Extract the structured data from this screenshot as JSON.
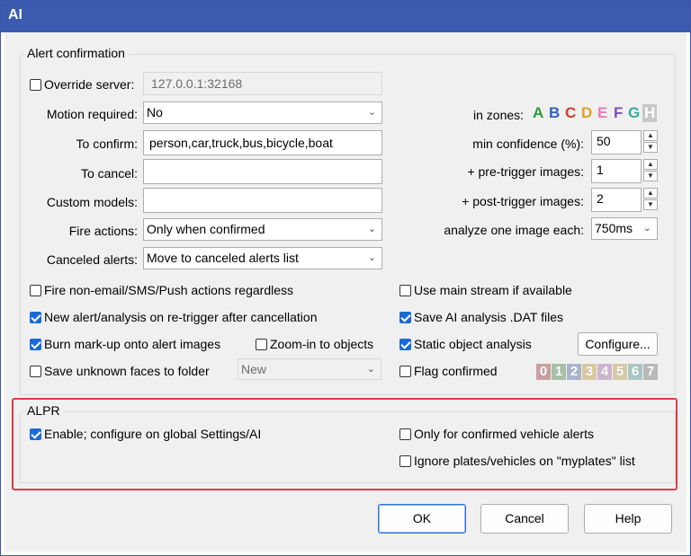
{
  "window": {
    "title": "AI"
  },
  "alert_confirmation": {
    "legend": "Alert confirmation",
    "override_server": {
      "label": "Override server:",
      "checked": false,
      "value": "127.0.0.1:32168"
    },
    "motion_required": {
      "label": "Motion required:",
      "value": "No"
    },
    "to_confirm": {
      "label": "To confirm:",
      "value": "person,car,truck,bus,bicycle,boat"
    },
    "to_cancel": {
      "label": "To cancel:",
      "value": ""
    },
    "custom_models": {
      "label": "Custom models:",
      "value": ""
    },
    "fire_actions": {
      "label": "Fire actions:",
      "value": "Only when confirmed"
    },
    "canceled_alerts": {
      "label": "Canceled alerts:",
      "value": "Move to canceled alerts list"
    },
    "in_zones": {
      "label": "in zones:",
      "letters": [
        "A",
        "B",
        "C",
        "D",
        "E",
        "F",
        "G",
        "H"
      ],
      "colors": [
        "#2e9a3a",
        "#2f5fc4",
        "#d23a2f",
        "#e0a020",
        "#e87ab8",
        "#7a4fb8",
        "#3aa8a0",
        "#8a8a8a"
      ]
    },
    "min_confidence": {
      "label": "min confidence (%):",
      "value": "50"
    },
    "pre_trigger": {
      "label": "+ pre-trigger images:",
      "value": "1"
    },
    "post_trigger": {
      "label": "+ post-trigger images:",
      "value": "2"
    },
    "analyze_each": {
      "label": "analyze one image each:",
      "value": "750ms"
    },
    "checkboxes": {
      "fire_non_email": {
        "label": "Fire non-email/SMS/Push actions regardless",
        "checked": false
      },
      "new_alert": {
        "label": "New alert/analysis on re-trigger after cancellation",
        "checked": true
      },
      "burn_markup": {
        "label": "Burn mark-up onto alert images",
        "checked": true
      },
      "zoom_in": {
        "label": "Zoom-in to objects",
        "checked": false
      },
      "save_unknown": {
        "label": "Save unknown faces to folder",
        "checked": false
      },
      "main_stream": {
        "label": "Use main stream if available",
        "checked": false
      },
      "save_dat": {
        "label": "Save AI analysis .DAT files",
        "checked": true
      },
      "static_object": {
        "label": "Static object analysis",
        "checked": true
      },
      "flag_confirmed": {
        "label": "Flag confirmed",
        "checked": false
      }
    },
    "folder_value": "New",
    "configure_label": "Configure...",
    "flag_digits": [
      "0",
      "1",
      "2",
      "3",
      "4",
      "5",
      "6",
      "7"
    ]
  },
  "alpr": {
    "legend": "ALPR",
    "enable": {
      "label": "Enable; configure on global Settings/AI",
      "checked": true
    },
    "only_confirmed": {
      "label": "Only for confirmed vehicle alerts",
      "checked": false
    },
    "ignore_plates": {
      "label": "Ignore plates/vehicles on \"myplates\" list",
      "checked": false
    }
  },
  "buttons": {
    "ok": "OK",
    "cancel": "Cancel",
    "help": "Help"
  }
}
